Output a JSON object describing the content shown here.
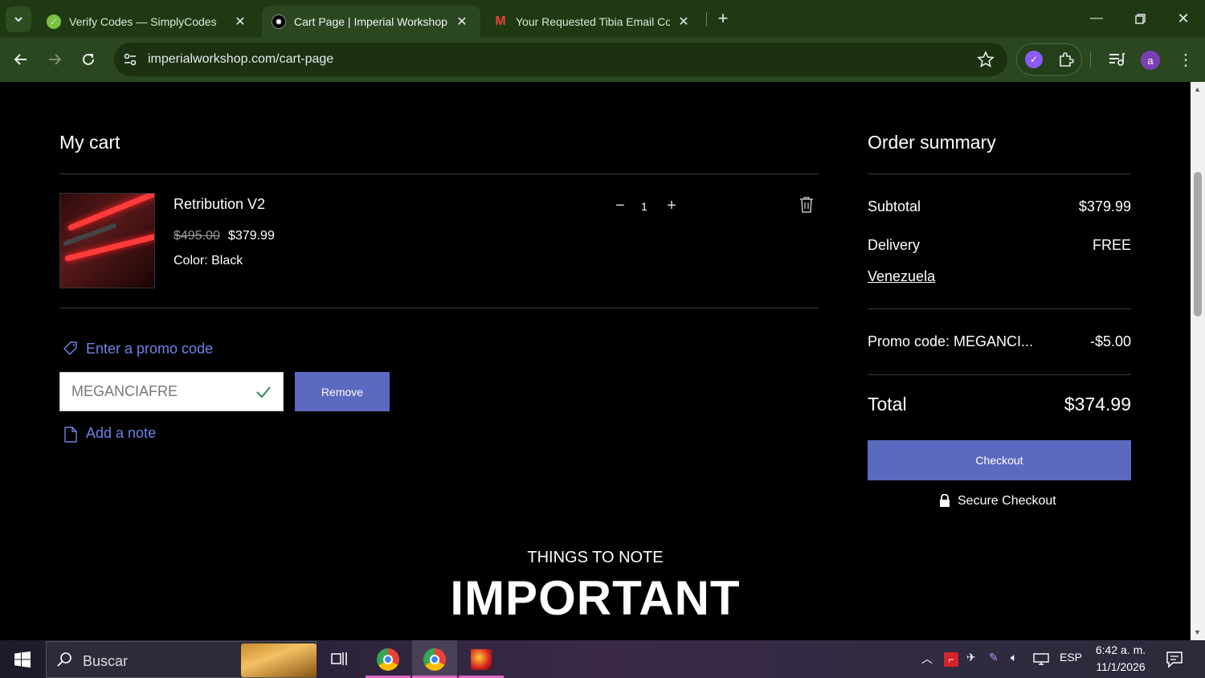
{
  "browser": {
    "tabs": [
      {
        "title": "Verify Codes — SimplyCodes",
        "active": false
      },
      {
        "title": "Cart Page | Imperial Workshop",
        "active": true
      },
      {
        "title": "Your Requested Tibia Email Cod",
        "active": false
      }
    ],
    "url": "imperialworkshop.com/cart-page",
    "profile_initial": "a"
  },
  "cart": {
    "heading": "My cart",
    "item": {
      "name": "Retribution V2",
      "old_price": "$495.00",
      "price": "$379.99",
      "color": "Color: Black",
      "quantity": "1"
    },
    "promo": {
      "link": "Enter a promo code",
      "code": "MEGANCIAFRE",
      "remove_label": "Remove"
    },
    "note_label": "Add a note"
  },
  "summary": {
    "heading": "Order summary",
    "subtotal_label": "Subtotal",
    "subtotal": "$379.99",
    "delivery_label": "Delivery",
    "delivery": "FREE",
    "country": "Venezuela",
    "promo_label": "Promo code: MEGANCI...",
    "promo_value": "-$5.00",
    "total_label": "Total",
    "total": "$374.99",
    "checkout_label": "Checkout",
    "secure_label": "Secure Checkout"
  },
  "notes": {
    "subheading": "THINGS TO NOTE",
    "heading": "IMPORTANT"
  },
  "taskbar": {
    "search_placeholder": "Buscar",
    "lang": "ESP",
    "time": "6:42 a. m.",
    "date": "11/1/2026"
  },
  "colors": {
    "accent": "#5b6abf",
    "link": "#6f82e6",
    "chrome_frame": "#1f3a13",
    "chrome_toolbar": "#2b4720"
  }
}
